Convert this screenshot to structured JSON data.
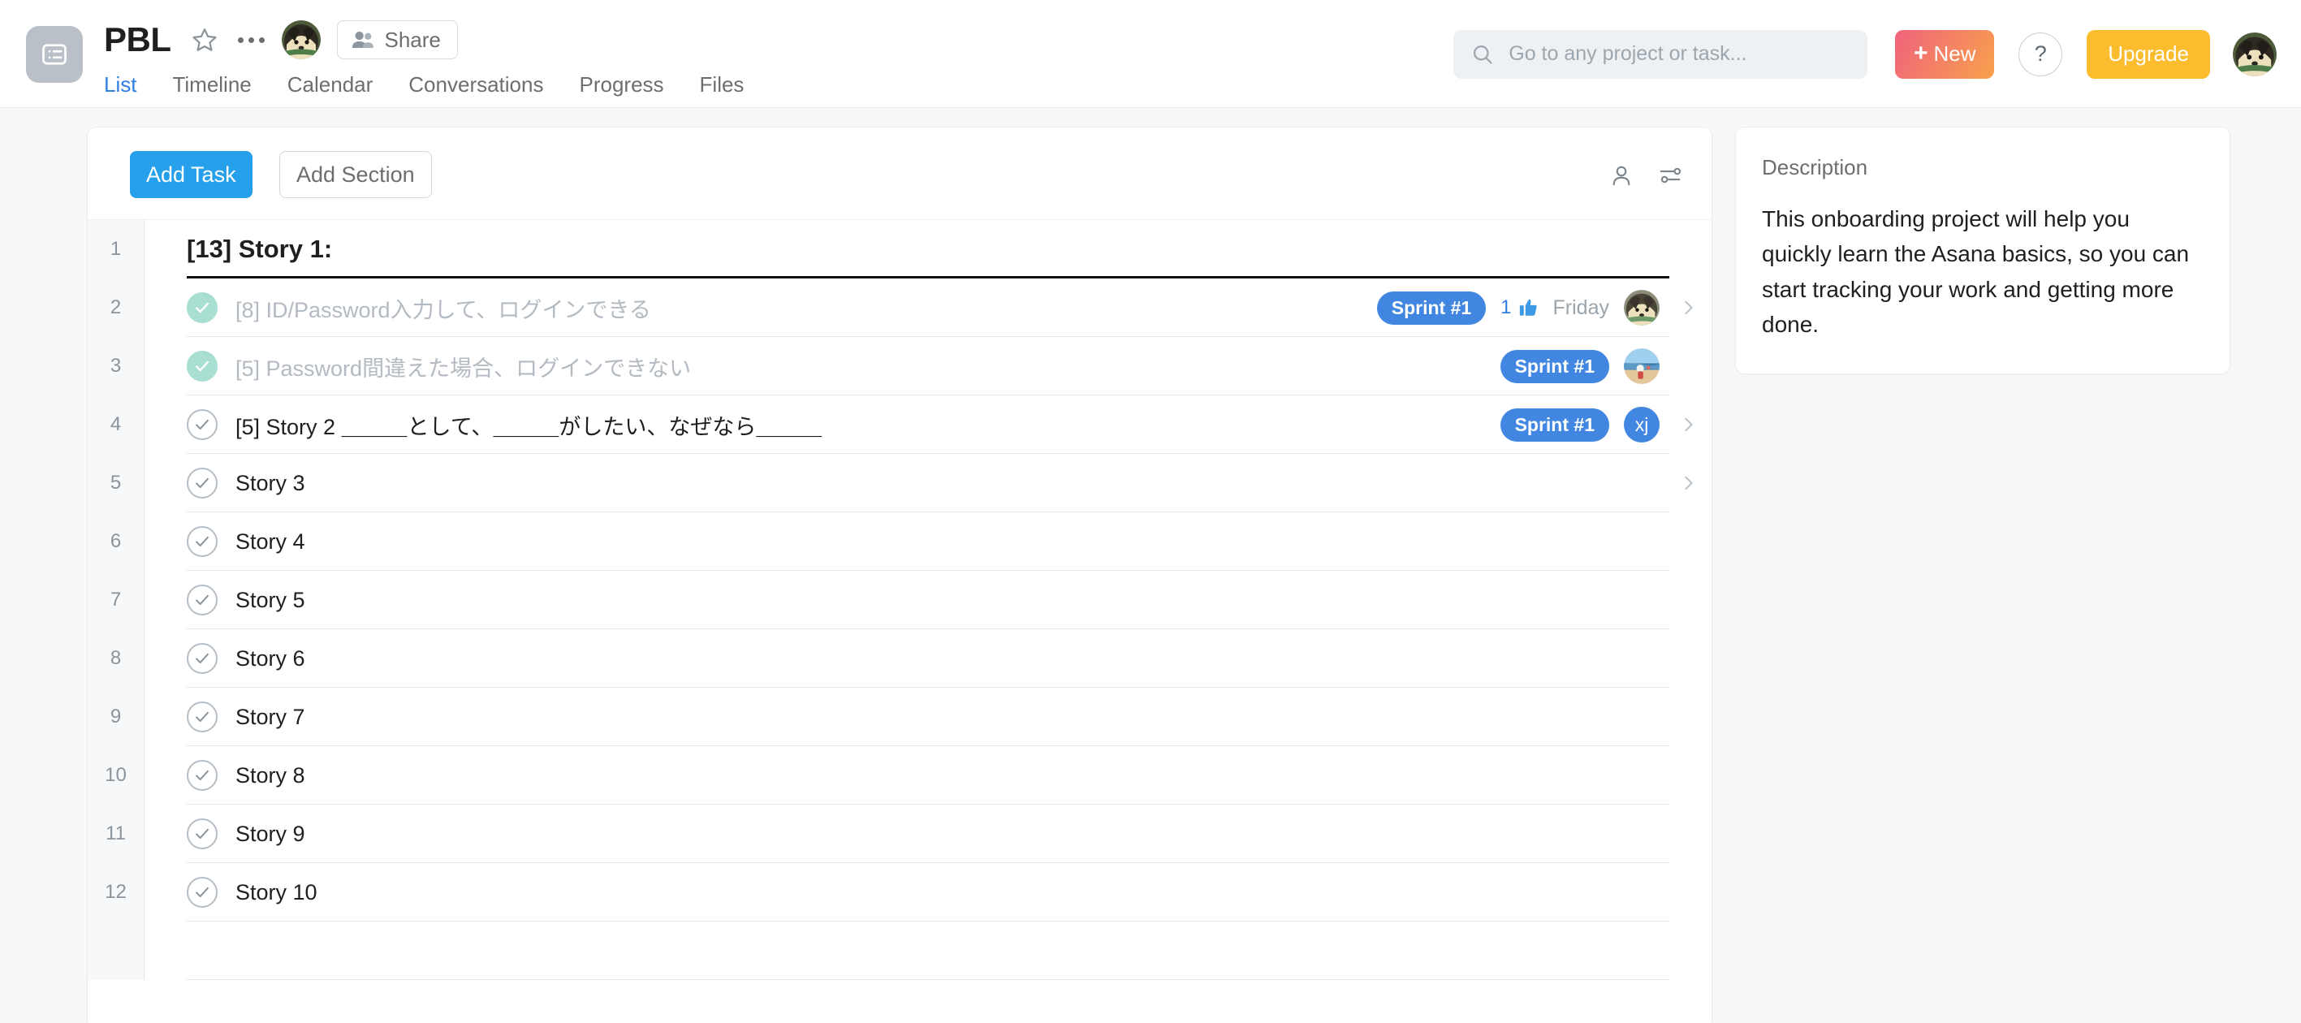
{
  "header": {
    "project_title": "PBL",
    "project_icon": "list-icon",
    "star_icon": "star-icon",
    "more_icon": "more-options-icon",
    "owner_avatar": "dog-avatar",
    "share_label": "Share",
    "share_icon": "people-icon",
    "tabs": [
      {
        "label": "List",
        "active": true
      },
      {
        "label": "Timeline",
        "active": false
      },
      {
        "label": "Calendar",
        "active": false
      },
      {
        "label": "Conversations",
        "active": false
      },
      {
        "label": "Progress",
        "active": false
      },
      {
        "label": "Files",
        "active": false
      }
    ],
    "search": {
      "placeholder": "Go to any project or task...",
      "value": "",
      "icon": "search-icon"
    },
    "new_button": {
      "label": "New",
      "plus": "+"
    },
    "help_button": {
      "label": "?"
    },
    "upgrade_button": {
      "label": "Upgrade"
    },
    "user_avatar": "dog-avatar"
  },
  "toolbar": {
    "add_task_label": "Add Task",
    "add_section_label": "Add Section",
    "person_icon": "person-icon",
    "filter_icon": "sort-filter-icon"
  },
  "rows": [
    {
      "num": "1",
      "kind": "section",
      "text": "[13] Story 1:",
      "completed": false,
      "checkbox": "none",
      "badge": "",
      "likes": "",
      "due": "",
      "avatar": "",
      "avatar_initials": "",
      "chevron": false
    },
    {
      "num": "2",
      "kind": "task",
      "text": "[8] ID/Password入力して、ログインできる",
      "completed": true,
      "checkbox": "done",
      "badge": "Sprint #1",
      "likes": "1",
      "due": "Friday",
      "avatar": "dog-avatar",
      "avatar_initials": "",
      "chevron": true
    },
    {
      "num": "3",
      "kind": "task",
      "text": "[5] Password間違えた場合、ログインできない",
      "completed": true,
      "checkbox": "done",
      "badge": "Sprint #1",
      "likes": "",
      "due": "",
      "avatar": "beach-avatar",
      "avatar_initials": "",
      "chevron": false
    },
    {
      "num": "4",
      "kind": "task",
      "text": "[5] Story 2 ＿＿＿として、＿＿＿がしたい、なぜなら＿＿＿",
      "completed": false,
      "checkbox": "open",
      "badge": "Sprint #1",
      "likes": "",
      "due": "",
      "avatar": "initials",
      "avatar_initials": "xj",
      "chevron": true
    },
    {
      "num": "5",
      "kind": "task",
      "text": "Story 3",
      "completed": false,
      "checkbox": "open",
      "badge": "",
      "likes": "",
      "due": "",
      "avatar": "",
      "avatar_initials": "",
      "chevron": true
    },
    {
      "num": "6",
      "kind": "task",
      "text": "Story 4",
      "completed": false,
      "checkbox": "open",
      "badge": "",
      "likes": "",
      "due": "",
      "avatar": "",
      "avatar_initials": "",
      "chevron": false
    },
    {
      "num": "7",
      "kind": "task",
      "text": "Story 5",
      "completed": false,
      "checkbox": "open",
      "badge": "",
      "likes": "",
      "due": "",
      "avatar": "",
      "avatar_initials": "",
      "chevron": false
    },
    {
      "num": "8",
      "kind": "task",
      "text": "Story 6",
      "completed": false,
      "checkbox": "open",
      "badge": "",
      "likes": "",
      "due": "",
      "avatar": "",
      "avatar_initials": "",
      "chevron": false
    },
    {
      "num": "9",
      "kind": "task",
      "text": "Story 7",
      "completed": false,
      "checkbox": "open",
      "badge": "",
      "likes": "",
      "due": "",
      "avatar": "",
      "avatar_initials": "",
      "chevron": false
    },
    {
      "num": "10",
      "kind": "task",
      "text": "Story 8",
      "completed": false,
      "checkbox": "open",
      "badge": "",
      "likes": "",
      "due": "",
      "avatar": "",
      "avatar_initials": "",
      "chevron": false
    },
    {
      "num": "11",
      "kind": "task",
      "text": "Story 9",
      "completed": false,
      "checkbox": "open",
      "badge": "",
      "likes": "",
      "due": "",
      "avatar": "",
      "avatar_initials": "",
      "chevron": false
    },
    {
      "num": "12",
      "kind": "task",
      "text": "Story 10",
      "completed": false,
      "checkbox": "open",
      "badge": "",
      "likes": "",
      "due": "",
      "avatar": "",
      "avatar_initials": "",
      "chevron": false
    },
    {
      "num": "",
      "kind": "blank",
      "text": "",
      "completed": false,
      "checkbox": "none",
      "badge": "",
      "likes": "",
      "due": "",
      "avatar": "",
      "avatar_initials": "",
      "chevron": false
    }
  ],
  "description": {
    "title": "Description",
    "body": "This onboarding project will help you quickly learn the Asana basics, so you can start tracking your work and getting more done."
  },
  "colors": {
    "accent_blue": "#27a0ec",
    "tab_active": "#2f7ee6",
    "badge_blue": "#4186e0",
    "done_green": "#a9ded2",
    "upgrade_yellow": "#fbbc2e",
    "new_pink": "#f0637c",
    "page_bg": "#f6f8f9"
  }
}
